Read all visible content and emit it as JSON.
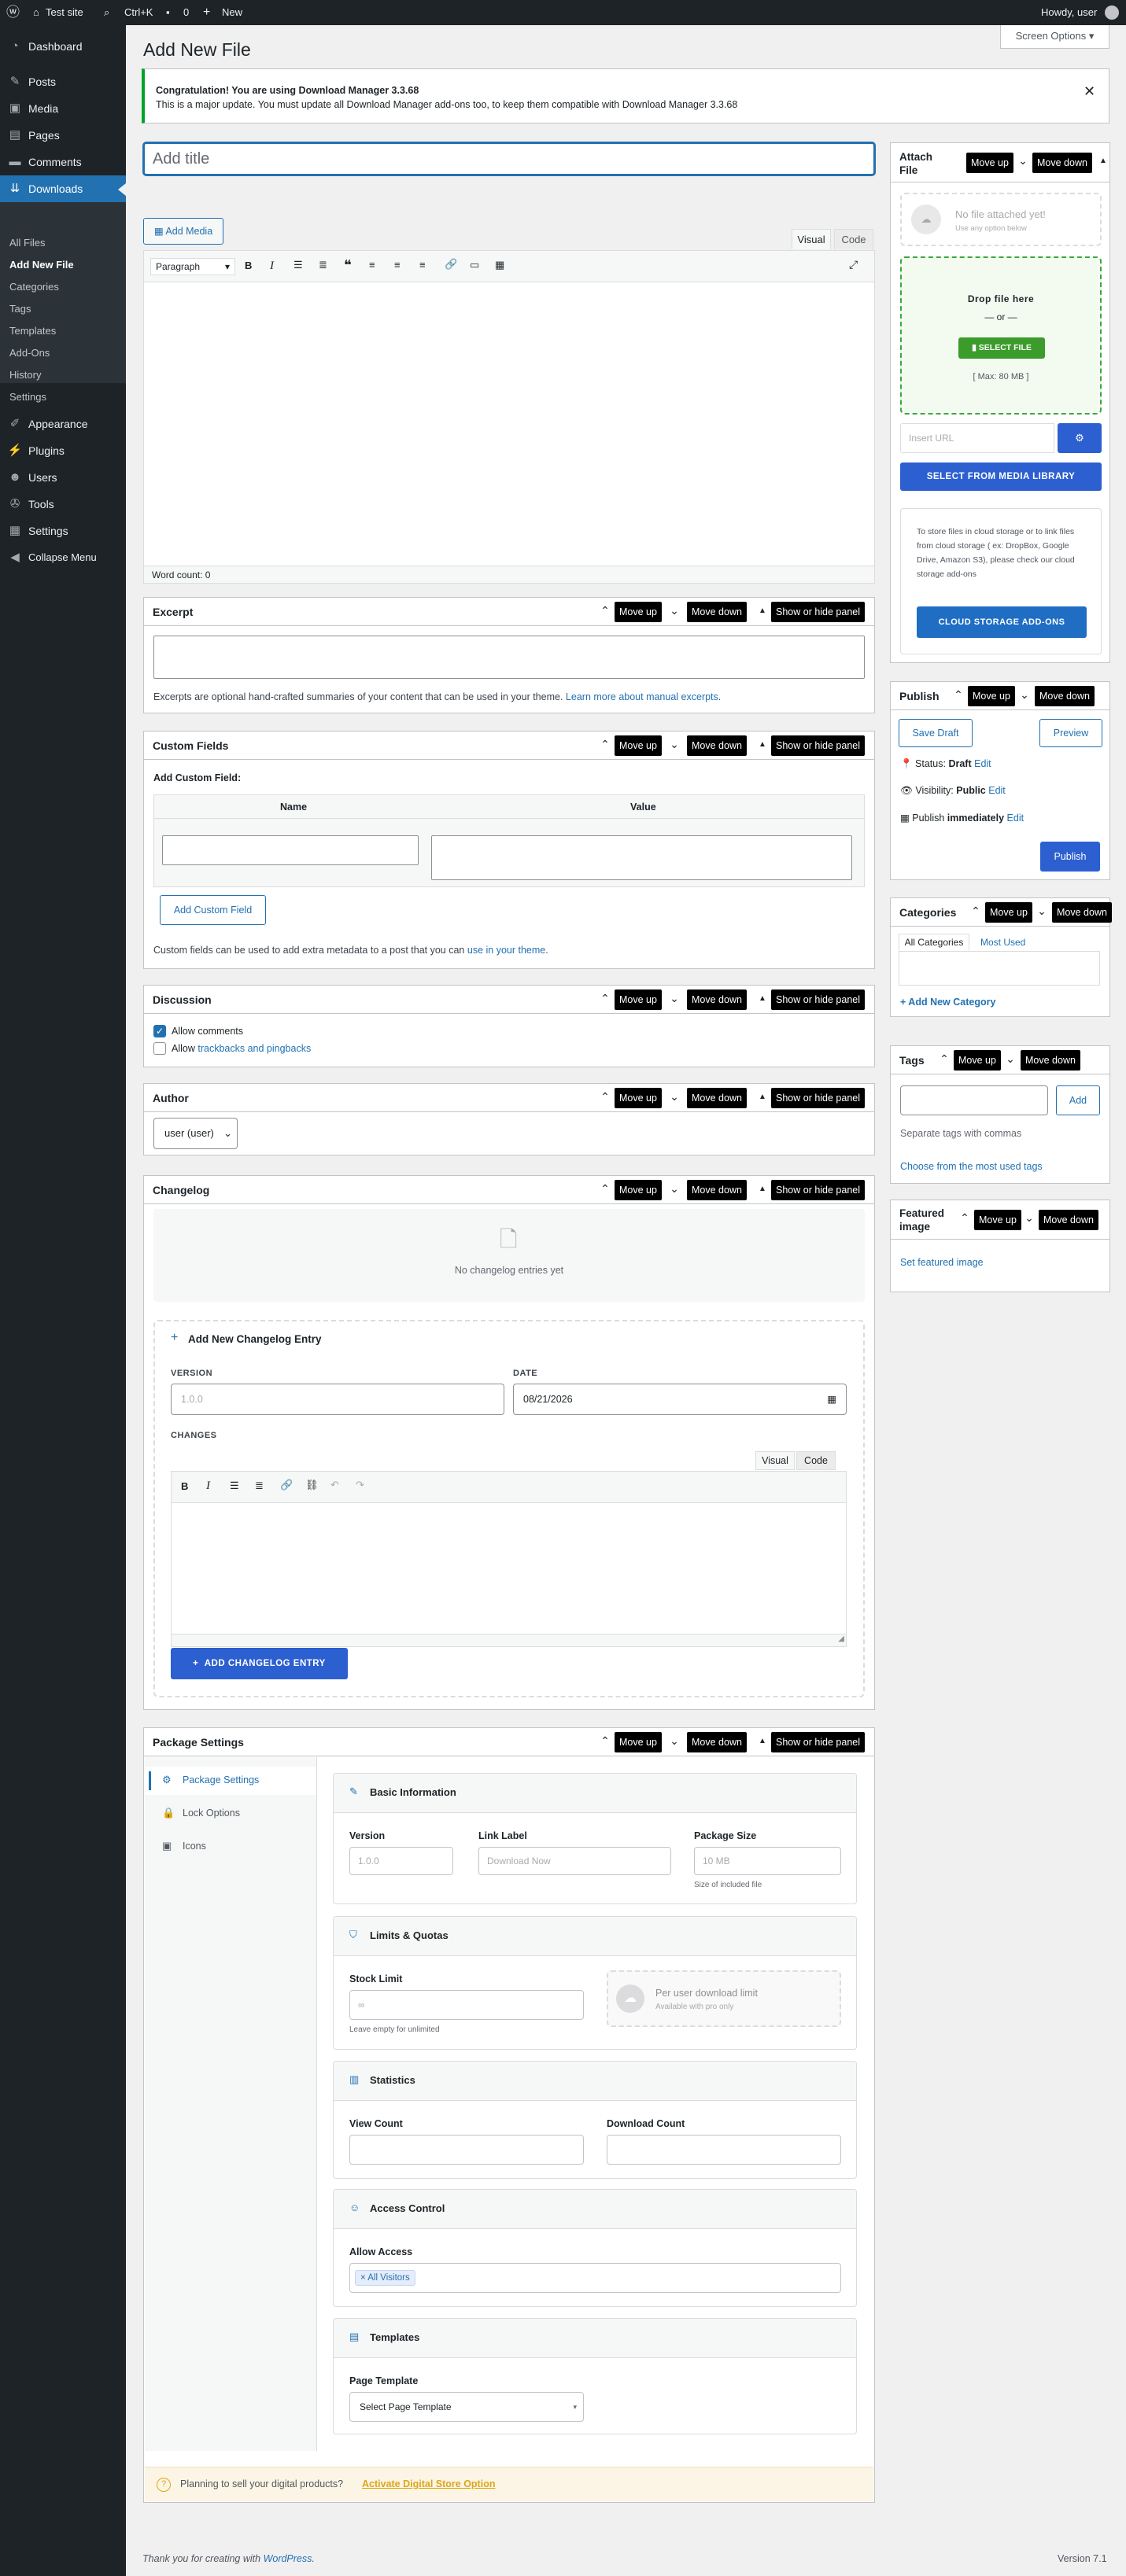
{
  "adminbar": {
    "site": "Test site",
    "search": "Ctrl+K",
    "comments": "0",
    "new": "New",
    "howdy": "Howdy, user"
  },
  "menu": {
    "dashboard": "Dashboard",
    "posts": "Posts",
    "media": "Media",
    "pages": "Pages",
    "comments": "Comments",
    "downloads": "Downloads",
    "sub": [
      "All Files",
      "Add New File",
      "Categories",
      "Tags",
      "Templates",
      "Add-Ons",
      "History",
      "Settings"
    ],
    "appearance": "Appearance",
    "plugins": "Plugins",
    "users": "Users",
    "tools": "Tools",
    "settings": "Settings",
    "collapse": "Collapse Menu"
  },
  "page": {
    "title": "Add New File",
    "screen_options": "Screen Options",
    "notice_title": "Congratulation! You are using Download Manager 3.3.68",
    "notice_text": "This is a major update. You must update all Download Manager add-ons too, to keep them compatible with Download Manager 3.3.68",
    "title_placeholder": "Add title"
  },
  "editor": {
    "add_media": "Add Media",
    "visual": "Visual",
    "code": "Code",
    "format": "Paragraph",
    "word_count": "Word count: 0"
  },
  "controls": {
    "move_up": "Move up",
    "move_down": "Move down",
    "toggle": "Show or hide panel"
  },
  "excerpt": {
    "title": "Excerpt",
    "help": "Excerpts are optional hand-crafted summaries of your content that can be used in your theme.",
    "link": "Learn more about manual excerpts"
  },
  "custom_fields": {
    "title": "Custom Fields",
    "add_label": "Add Custom Field:",
    "col_name": "Name",
    "col_value": "Value",
    "add_button": "Add Custom Field",
    "help": "Custom fields can be used to add extra metadata to a post that you can",
    "link": "use in your theme"
  },
  "discussion": {
    "title": "Discussion",
    "allow_comments": "Allow comments",
    "allow_track_pre": "Allow",
    "allow_track_link": "trackbacks and pingbacks"
  },
  "author": {
    "title": "Author",
    "value": "user (user)"
  },
  "changelog": {
    "title": "Changelog",
    "empty": "No changelog entries yet",
    "add_title": "Add New Changelog Entry",
    "version_label": "VERSION",
    "version_ph": "1.0.0",
    "date_label": "DATE",
    "date_value": "08/21/2026",
    "changes_label": "CHANGES",
    "visual": "Visual",
    "code": "Code",
    "add_button": "ADD CHANGELOG ENTRY"
  },
  "package": {
    "title": "Package Settings",
    "nav": [
      "Package Settings",
      "Lock Options",
      "Icons"
    ],
    "basic": {
      "title": "Basic Information",
      "version": "Version",
      "version_ph": "1.0.0",
      "link_label": "Link Label",
      "link_ph": "Download Now",
      "size": "Package Size",
      "size_ph": "10 MB",
      "size_help": "Size of included file"
    },
    "limits": {
      "title": "Limits & Quotas",
      "stock": "Stock Limit",
      "stock_ph": "∞",
      "stock_help": "Leave empty for unlimited",
      "per_user": "Per user download limit",
      "pro": "Available with pro only"
    },
    "stats": {
      "title": "Statistics",
      "views": "View Count",
      "downloads": "Download Count"
    },
    "access": {
      "title": "Access Control",
      "allow": "Allow Access",
      "tag": "All Visitors"
    },
    "templates": {
      "title": "Templates",
      "page_template": "Page Template",
      "select": "Select Page Template"
    },
    "sell_text": "Planning to sell your digital products?",
    "sell_link": "Activate Digital Store Option"
  },
  "attach": {
    "title": "Attach File",
    "no_file": "No file attached yet!",
    "use_option": "Use any option below",
    "drop": "Drop file here",
    "or": "— or —",
    "select": "SELECT FILE",
    "max": "[ Max: 80 MB ]",
    "url_ph": "Insert URL",
    "library": "SELECT FROM MEDIA LIBRARY",
    "cloud_text": "To store files in cloud storage or to link files from cloud storage ( ex: DropBox, Google Drive, Amazon S3), please check our cloud storage add-ons",
    "cloud_button": "CLOUD STORAGE ADD-ONS"
  },
  "publish": {
    "title": "Publish",
    "save_draft": "Save Draft",
    "preview": "Preview",
    "status_label": "Status:",
    "status": "Draft",
    "visibility_label": "Visibility:",
    "visibility": "Public",
    "publish_label": "Publish",
    "publish_when": "immediately",
    "edit": "Edit",
    "button": "Publish"
  },
  "categories": {
    "title": "Categories",
    "all": "All Categories",
    "used": "Most Used",
    "add": "+ Add New Category"
  },
  "tags": {
    "title": "Tags",
    "add": "Add",
    "help": "Separate tags with commas",
    "choose": "Choose from the most used tags"
  },
  "featured": {
    "title": "Featured image",
    "set": "Set featured image"
  },
  "footer": {
    "thanks": "Thank you for creating with",
    "wp": "WordPress",
    "version": "Version 7.1"
  }
}
